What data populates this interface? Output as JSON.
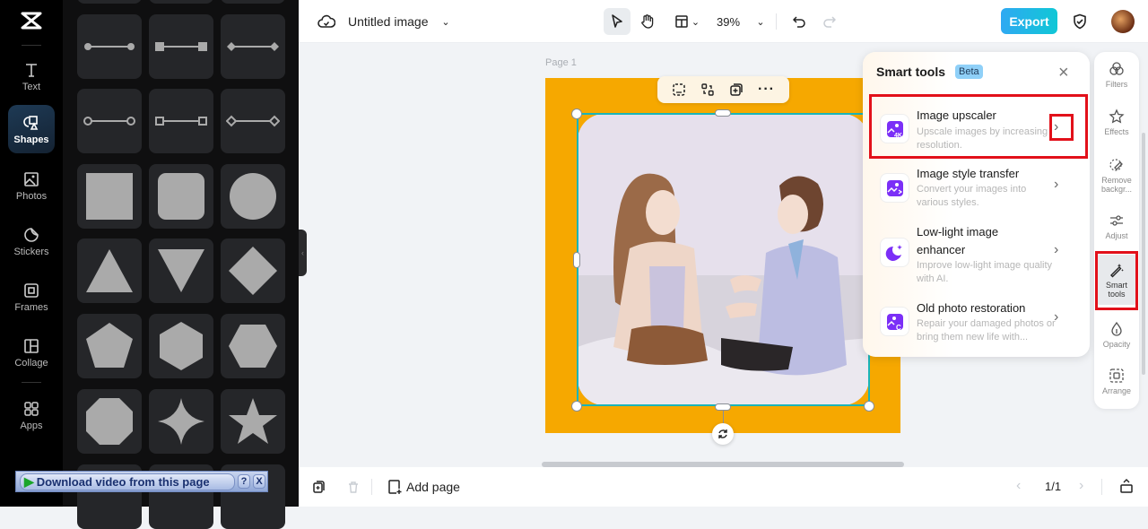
{
  "rail": {
    "items": [
      {
        "label": "Text",
        "icon": "text-icon"
      },
      {
        "label": "Shapes",
        "icon": "shapes-icon",
        "active": true
      },
      {
        "label": "Photos",
        "icon": "photos-icon"
      },
      {
        "label": "Stickers",
        "icon": "stickers-icon"
      },
      {
        "label": "Frames",
        "icon": "frames-icon"
      },
      {
        "label": "Collage",
        "icon": "collage-icon"
      },
      {
        "label": "Apps",
        "icon": "apps-icon"
      }
    ]
  },
  "shapes_panel": {
    "tiles": [
      "line-dot-ends",
      "line-square-ends",
      "line-diamond-ends",
      "line-open-circle-ends",
      "line-open-square-ends",
      "line-open-diamond-ends",
      "square",
      "rounded-square",
      "circle",
      "triangle",
      "inverted-triangle",
      "diamond",
      "pentagon",
      "hexagon-vertical",
      "hexagon-horizontal",
      "octagon",
      "four-point-star",
      "five-point-star"
    ]
  },
  "topbar": {
    "title": "Untitled image",
    "zoom": "39%",
    "export_label": "Export"
  },
  "canvas": {
    "page_label": "Page 1",
    "page_color": "#f6a800",
    "selection_color": "#1ab4b8"
  },
  "smart_tools": {
    "title": "Smart tools",
    "badge": "Beta",
    "tools": [
      {
        "name": "Image upscaler",
        "desc": "Upscale images by increasing resolution.",
        "icon": "upscale-4k-icon",
        "highlighted": true
      },
      {
        "name": "Image style transfer",
        "desc": "Convert your images into various styles.",
        "icon": "style-transfer-icon"
      },
      {
        "name": "Low-light image enhancer",
        "desc": "Improve low-light image quality with AI.",
        "icon": "moon-sparkle-icon"
      },
      {
        "name": "Old photo restoration",
        "desc": "Repair your damaged photos or bring them new life with...",
        "icon": "photo-restore-icon"
      }
    ],
    "accent": "#7b2ff7"
  },
  "right_sidebar": {
    "items": [
      {
        "label": "Filters"
      },
      {
        "label": "Effects"
      },
      {
        "label": "Remove backgr..."
      },
      {
        "label": "Adjust"
      },
      {
        "label": "Smart tools",
        "active": true
      },
      {
        "label": "Opacity"
      },
      {
        "label": "Arrange"
      }
    ]
  },
  "bottombar": {
    "add_page_label": "Add page",
    "page_counter": "1/1"
  },
  "download_bar": {
    "label": "Download video from this page",
    "help": "?",
    "close": "X"
  }
}
